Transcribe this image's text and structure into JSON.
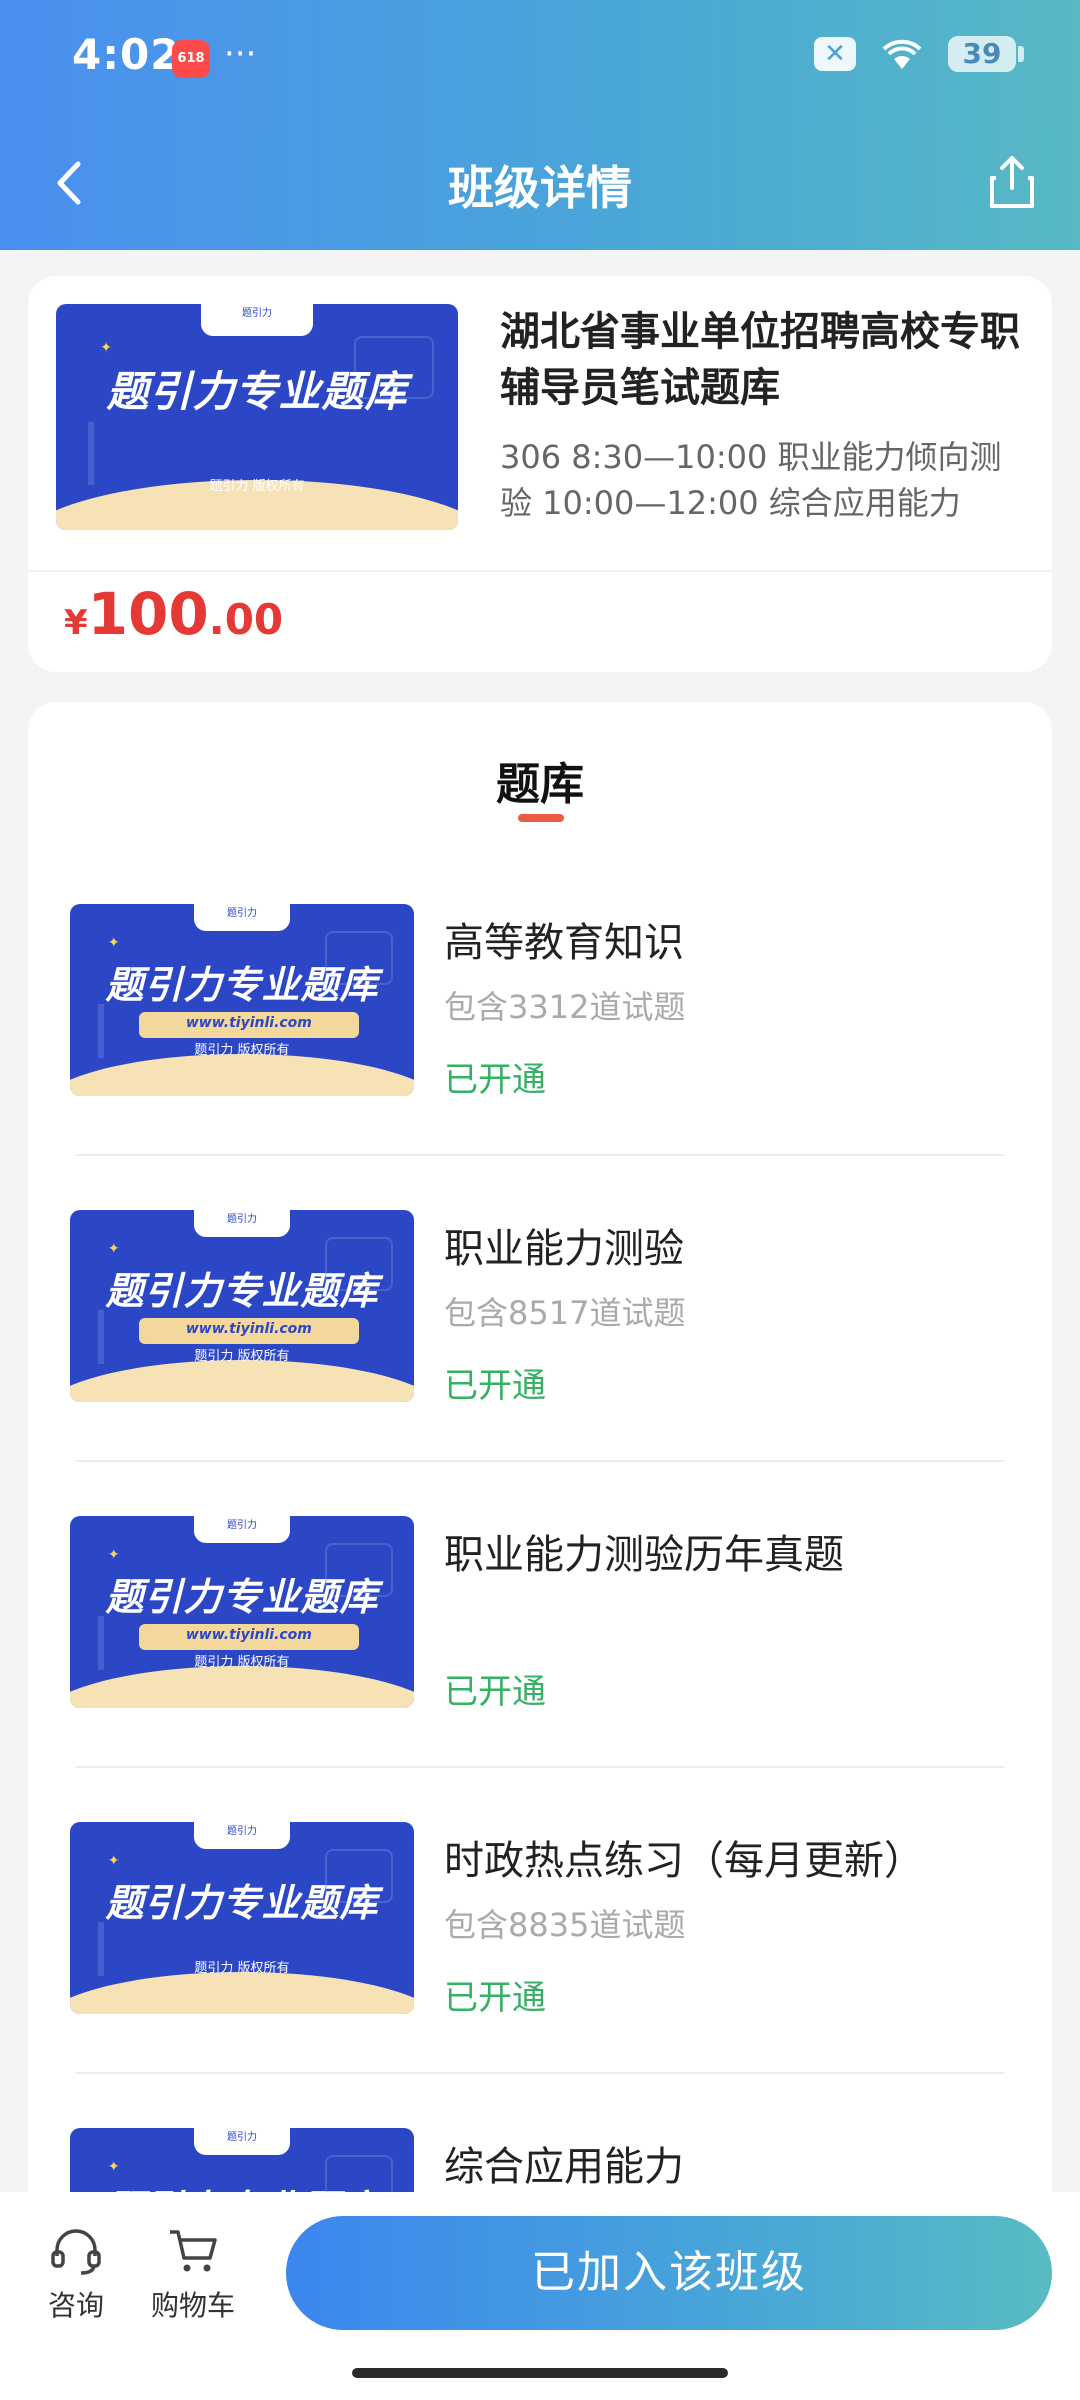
{
  "status_bar": {
    "time": "4:02",
    "badge": "618",
    "dots": "···",
    "battery": "39"
  },
  "navbar": {
    "title": "班级详情",
    "back_icon": "chevron-left-icon",
    "share_icon": "share-icon"
  },
  "course": {
    "title": "湖北省事业单位招聘高校专职辅导员笔试题库",
    "description": "306 8:30—10:00 职业能力倾向测验 10:00—12:00 综合应用能力",
    "price_currency": "¥",
    "price_integer": "100",
    "price_decimal": ".00",
    "thumbnail": {
      "tab": "题引力",
      "banner": "题引力专业题库",
      "copyright": "题引力 版权所有"
    }
  },
  "bank": {
    "tab_label": "题库",
    "items": [
      {
        "name": "高等教育知识",
        "count": "包含3312道试题",
        "status": "已开通",
        "url": "www.tiyinli.com"
      },
      {
        "name": "职业能力测验",
        "count": "包含8517道试题",
        "status": "已开通",
        "url": "www.tiyinli.com"
      },
      {
        "name": "职业能力测验历年真题",
        "count": "",
        "status": "已开通",
        "url": "www.tiyinli.com"
      },
      {
        "name": "时政热点练习（每月更新）",
        "count": "包含8835道试题",
        "status": "已开通",
        "url": ""
      },
      {
        "name": "综合应用能力",
        "count": "",
        "status": "",
        "url": ""
      }
    ],
    "thumb_tab": "题引力",
    "thumb_banner": "题引力专业题库",
    "thumb_copy": "题引力 版权所有"
  },
  "bottom_bar": {
    "consult_label": "咨询",
    "cart_label": "购物车",
    "join_label": "已加入该班级"
  },
  "colors": {
    "header_start": "#4a8ff0",
    "header_end": "#58b9c4",
    "price": "#e53935",
    "status_green": "#35b064",
    "tab_underline": "#e95c43"
  }
}
